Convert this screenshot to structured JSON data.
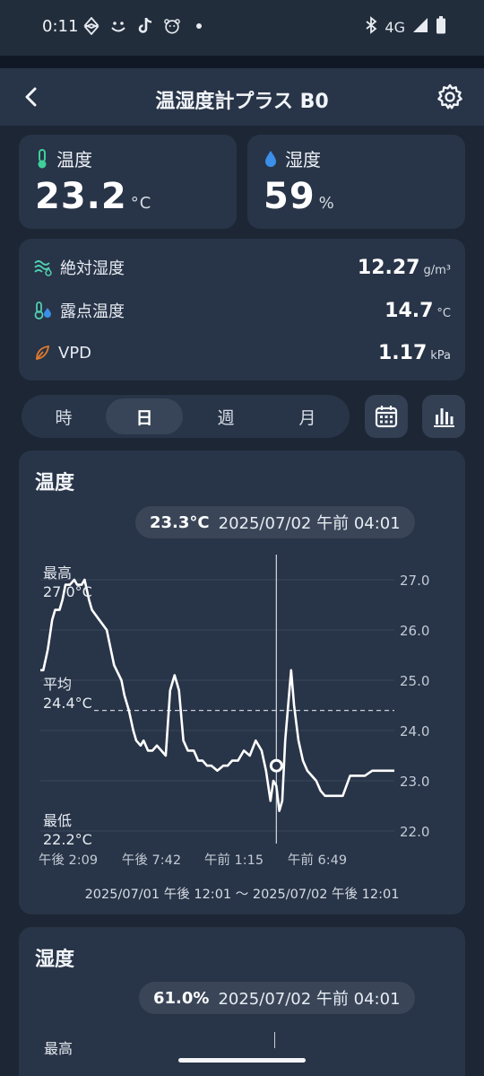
{
  "status_bar": {
    "time": "0:11",
    "network": "4G",
    "notification_icons": [
      "link-icon",
      "smiley-icon",
      "tiktok-icon",
      "bear-icon",
      "dot-icon"
    ]
  },
  "app_bar": {
    "title": "温湿度計プラス B0"
  },
  "metrics": {
    "temperature": {
      "label": "温度",
      "value": "23.2",
      "unit": "°C",
      "color": "#3ecf9a"
    },
    "humidity": {
      "label": "湿度",
      "value": "59",
      "unit": "%",
      "color": "#3b8fe8"
    }
  },
  "details": [
    {
      "label": "絶対湿度",
      "value": "12.27",
      "unit": "g/m³",
      "icon": "absolute-humidity-icon"
    },
    {
      "label": "露点温度",
      "value": "14.7",
      "unit": "°C",
      "icon": "dew-point-icon"
    },
    {
      "label": "VPD",
      "value": "1.17",
      "unit": "kPa",
      "icon": "leaf-icon"
    }
  ],
  "range_tabs": {
    "items": [
      "時",
      "日",
      "週",
      "月"
    ],
    "selected": "日"
  },
  "temp_chart": {
    "title": "温度",
    "tooltip_value": "23.3°C",
    "tooltip_time": "2025/07/02 午前 04:01",
    "max_label": "最高",
    "max_value": "27.0°C",
    "avg_label": "平均",
    "avg_value": "24.4°C",
    "min_label": "最低",
    "min_value": "22.2°C",
    "range_text": "2025/07/01 午後 12:01 ～ 2025/07/02 午後 12:01"
  },
  "humidity_chart": {
    "title": "湿度",
    "tooltip_value": "61.0%",
    "tooltip_time": "2025/07/02 午前 04:01",
    "max_label": "最高"
  },
  "chart_data": {
    "type": "line",
    "title": "温度",
    "ylim": [
      22.0,
      27.0
    ],
    "yticks": [
      "27.0",
      "26.0",
      "25.0",
      "24.0",
      "23.0",
      "22.0"
    ],
    "xticks": [
      "午後 2:09",
      "午後 7:42",
      "午前 1:15",
      "午前 6:49"
    ],
    "xlim": [
      0,
      24
    ],
    "average": 24.4,
    "selected_x": 16.0,
    "selected_y": 23.3,
    "grid": true,
    "series": [
      {
        "color": "#ffffff",
        "x": [
          0,
          0.2,
          0.5,
          0.6,
          0.8,
          1.0,
          1.3,
          1.5,
          1.7,
          2.0,
          2.3,
          2.5,
          2.8,
          3.0,
          3.3,
          3.5,
          4.0,
          4.5,
          5.0,
          5.5,
          5.7,
          6.0,
          6.3,
          6.5,
          6.8,
          7.0,
          7.3,
          7.6,
          7.9,
          8.2,
          8.5,
          8.8,
          9.1,
          9.4,
          9.7,
          10.0,
          10.4,
          10.7,
          11.0,
          11.3,
          11.6,
          12.0,
          12.4,
          12.7,
          13.0,
          13.4,
          13.8,
          14.2,
          14.6,
          15.0,
          15.3,
          15.6,
          15.8,
          16.0,
          16.2,
          16.4,
          16.6,
          16.8,
          17.0,
          17.2,
          17.5,
          17.8,
          18.1,
          18.4,
          18.7,
          19.0,
          19.3,
          19.6,
          20.0,
          20.5,
          21.0,
          21.5,
          22.0,
          22.5,
          23.0,
          23.5,
          24.0
        ],
        "y": [
          25.2,
          25.2,
          25.6,
          25.8,
          26.2,
          26.4,
          26.4,
          26.6,
          26.9,
          26.9,
          27.0,
          26.9,
          26.9,
          27.0,
          26.6,
          26.4,
          26.2,
          26.0,
          25.3,
          25.0,
          24.7,
          24.4,
          24.0,
          23.8,
          23.7,
          23.8,
          23.6,
          23.6,
          23.7,
          23.6,
          23.5,
          24.8,
          25.1,
          24.8,
          23.8,
          23.6,
          23.6,
          23.4,
          23.4,
          23.3,
          23.3,
          23.2,
          23.3,
          23.3,
          23.4,
          23.4,
          23.6,
          23.5,
          23.8,
          23.6,
          23.2,
          22.6,
          23.0,
          22.9,
          22.4,
          22.6,
          23.8,
          24.5,
          25.2,
          24.5,
          23.8,
          23.4,
          23.2,
          23.1,
          23.0,
          22.8,
          22.7,
          22.7,
          22.7,
          22.7,
          23.1,
          23.1,
          23.1,
          23.2,
          23.2,
          23.2,
          23.2
        ]
      }
    ]
  }
}
